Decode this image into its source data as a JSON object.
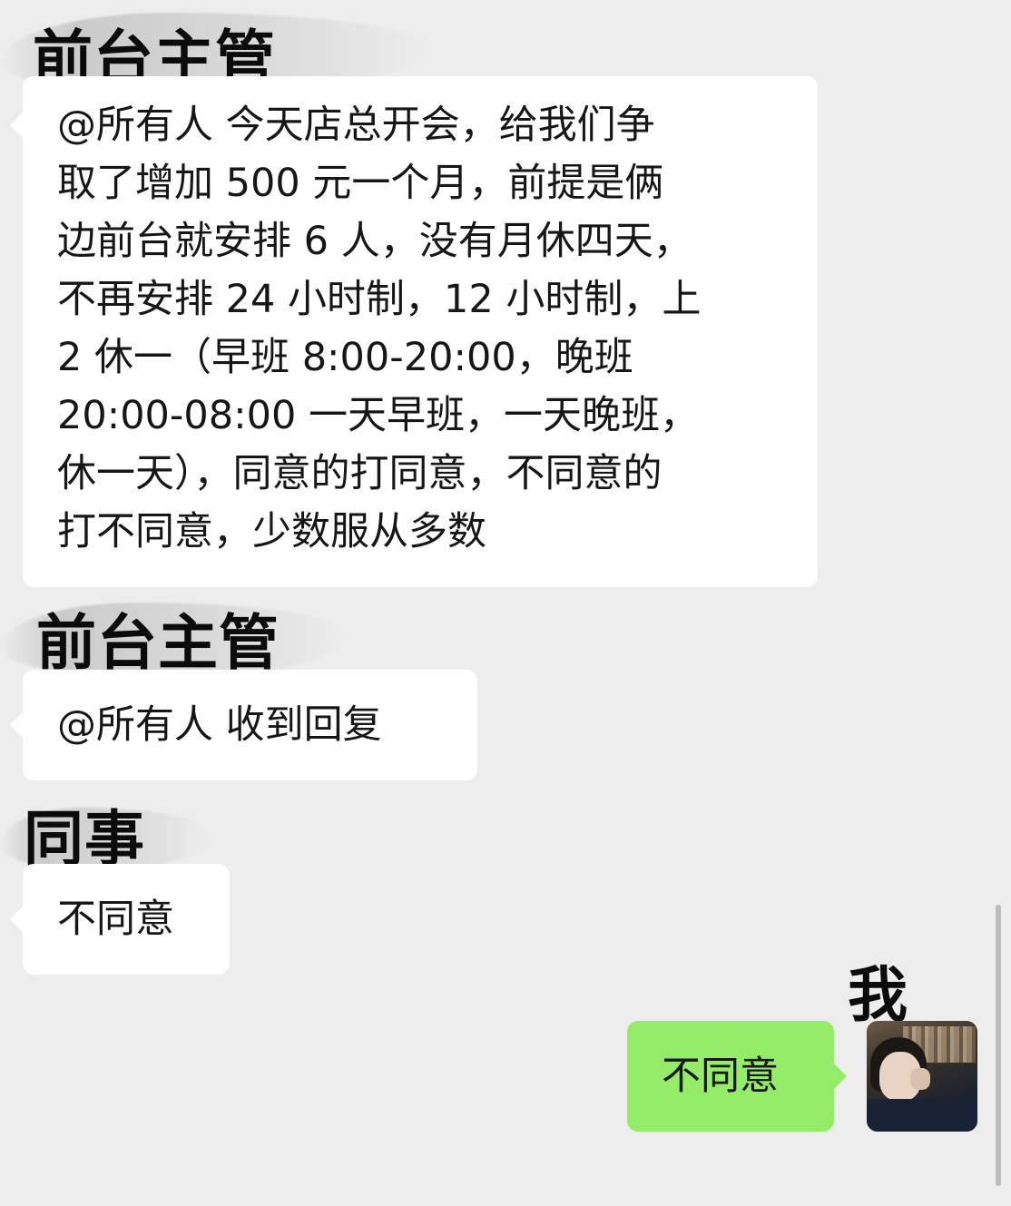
{
  "messages": [
    {
      "sender": "前台主管",
      "side": "left",
      "lines": [
        "@所有人 今天店总开会，给我们争",
        "取了增加 500 元一个月，前提是俩",
        "边前台就安排 6 人，没有月休四天，",
        "不再安排 24 小时制，12 小时制，上",
        "2 休一（早班 8:00-20:00，晚班",
        "20:00-08:00 一天早班，一天晚班，",
        "休一天），同意的打同意，不同意的",
        "打不同意，少数服从多数"
      ]
    },
    {
      "sender": "前台主管",
      "side": "left",
      "lines": [
        "@所有人 收到回复"
      ]
    },
    {
      "sender": "同事",
      "side": "left",
      "lines": [
        "不同意"
      ]
    },
    {
      "sender": "我",
      "side": "right",
      "lines": [
        "不同意"
      ]
    }
  ],
  "colors": {
    "background": "#ededed",
    "incoming_bubble": "#ffffff",
    "outgoing_bubble": "#95ec69",
    "scrollbar": "#bdbdbd"
  },
  "icons": {
    "avatar": "user-avatar-photo"
  }
}
